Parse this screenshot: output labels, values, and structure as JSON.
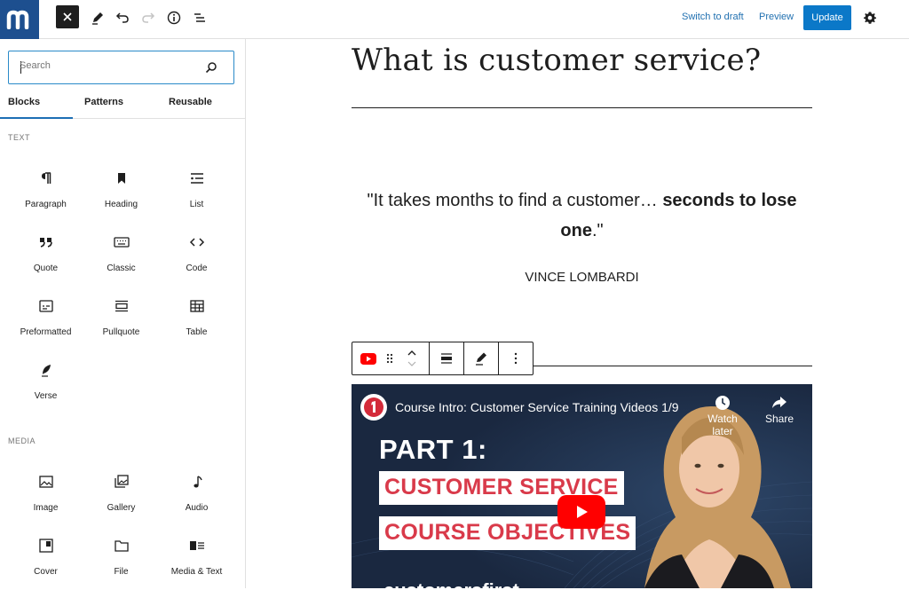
{
  "topbar": {
    "switch_draft": "Switch to draft",
    "preview": "Preview",
    "update": "Update"
  },
  "sidebar": {
    "search_placeholder": "Search",
    "tabs": [
      "Blocks",
      "Patterns",
      "Reusable"
    ],
    "section_text": "TEXT",
    "section_media": "MEDIA",
    "text_blocks": [
      "Paragraph",
      "Heading",
      "List",
      "Quote",
      "Classic",
      "Code",
      "Preformatted",
      "Pullquote",
      "Table",
      "Verse"
    ],
    "media_blocks": [
      "Image",
      "Gallery",
      "Audio",
      "Cover",
      "File",
      "Media & Text"
    ]
  },
  "editor": {
    "title": "What is customer service?",
    "quote_normal": "\"It takes months to find a customer… ",
    "quote_bold": "seconds to lose one",
    "quote_end": ".\"",
    "citation": "VINCE LOMBARDI"
  },
  "video": {
    "title": "Course Intro: Customer Service Training Videos 1/9",
    "watch_later": "Watch later",
    "share": "Share",
    "part": "PART 1:",
    "line1": "CUSTOMER SERVICE",
    "line2": "COURSE OBJECTIVES",
    "brand": "customersfirst"
  },
  "colors": {
    "logo_bg": "#1d4f8f",
    "link": "#2271b1",
    "update_btn": "#0b78c8",
    "video_bg": "#1c2c44",
    "video_red": "#d93a4a"
  }
}
